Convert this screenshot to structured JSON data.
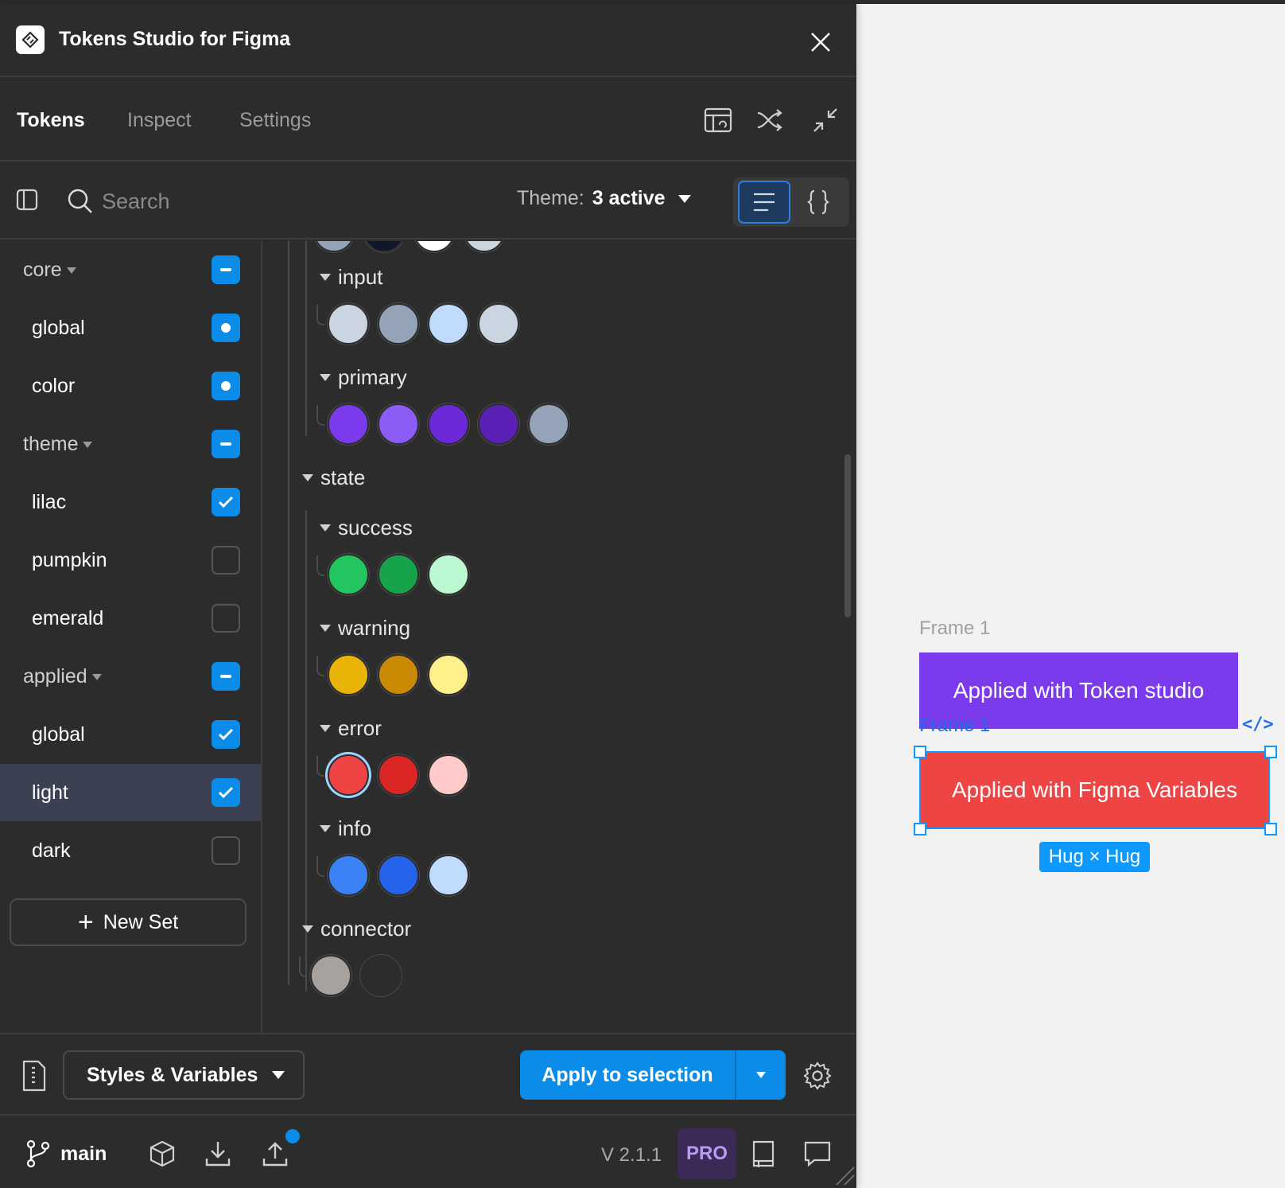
{
  "app": {
    "title": "Tokens Studio for Figma"
  },
  "tabs": [
    {
      "label": "Tokens",
      "active": true
    },
    {
      "label": "Inspect",
      "active": false
    },
    {
      "label": "Settings",
      "active": false
    }
  ],
  "toolbar_icons": [
    "page-layout-icon",
    "shuffle-icon",
    "minimize-icon"
  ],
  "search": {
    "placeholder": "Search"
  },
  "theme": {
    "label": "Theme:",
    "value": "3 active"
  },
  "view_modes": [
    "list-view-icon",
    "json-view-icon"
  ],
  "sets": [
    {
      "label": "core",
      "type": "group",
      "state": "partial"
    },
    {
      "label": "global",
      "type": "set",
      "state": "source"
    },
    {
      "label": "color",
      "type": "set",
      "state": "source"
    },
    {
      "label": "theme",
      "type": "group",
      "state": "partial"
    },
    {
      "label": "lilac",
      "type": "set",
      "state": "checked"
    },
    {
      "label": "pumpkin",
      "type": "set",
      "state": "unchecked"
    },
    {
      "label": "emerald",
      "type": "set",
      "state": "unchecked"
    },
    {
      "label": "applied",
      "type": "group",
      "state": "partial"
    },
    {
      "label": "global",
      "type": "set",
      "state": "checked"
    },
    {
      "label": "light",
      "type": "set",
      "state": "checked",
      "selected": true
    },
    {
      "label": "dark",
      "type": "set",
      "state": "unchecked"
    }
  ],
  "new_set_label": "New Set",
  "token_groups": {
    "top_partial_colors": [
      "#94a3b8",
      "#0f172a",
      "#ffffff",
      "#cbd5e1"
    ],
    "input": {
      "label": "input",
      "colors": [
        "#cbd5e1",
        "#94a3b8",
        "#bfdbfe",
        "#cbd5e1"
      ]
    },
    "primary": {
      "label": "primary",
      "colors": [
        "#7c3aed",
        "#8b5cf6",
        "#6d28d9",
        "#5b21b6",
        "#94a3b8"
      ]
    },
    "state": {
      "label": "state"
    },
    "success": {
      "label": "success",
      "colors": [
        "#22c55e",
        "#16a34a",
        "#bbf7d0"
      ]
    },
    "warning": {
      "label": "warning",
      "colors": [
        "#eab308",
        "#ca8a04",
        "#fef08a"
      ]
    },
    "error": {
      "label": "error",
      "colors": [
        "#ef4444",
        "#dc2626",
        "#fecaca"
      ]
    },
    "info": {
      "label": "info",
      "colors": [
        "#3b82f6",
        "#2563eb",
        "#bfdbfe"
      ]
    },
    "connector": {
      "label": "connector",
      "colors": [
        "#a8a29e",
        "#2c2c2c"
      ]
    }
  },
  "footer": {
    "styles_select": "Styles & Variables",
    "apply_label": "Apply to selection",
    "branch": "main",
    "version": "V 2.1.1",
    "pro": "PRO"
  },
  "canvas": {
    "frame1_label": "Frame 1",
    "frame1_text": "Applied with Token studio",
    "frame2_label": "Frame 1",
    "frame2_text": "Applied with Figma Variables",
    "code_icon": "</>",
    "hug_badge": "Hug × Hug"
  },
  "colors": {
    "accent": "#0c8ce9",
    "panel": "#2c2c2c",
    "selection": "#0d99ff"
  }
}
